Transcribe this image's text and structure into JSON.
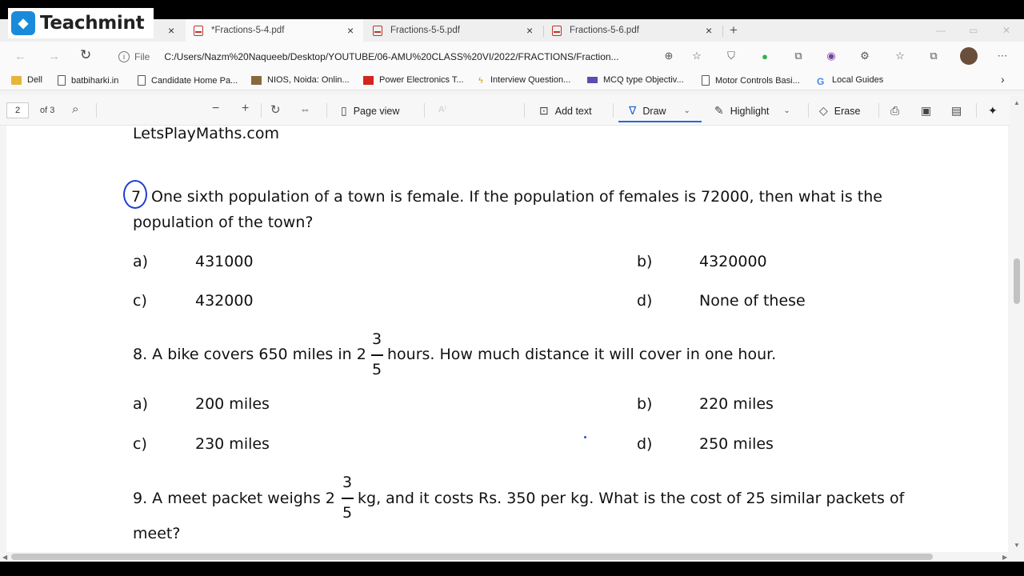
{
  "logo": {
    "text": "Teachmint"
  },
  "tabs": [
    {
      "title": "*Fractions-5-4.pdf"
    },
    {
      "title": "Fractions-5-5.pdf"
    },
    {
      "title": "Fractions-5-6.pdf"
    }
  ],
  "tab_close_glyph": "×",
  "new_tab_glyph": "+",
  "address": {
    "file_label": "File",
    "url": "C:/Users/Nazm%20Naqueeb/Desktop/YOUTUBE/06-AMU%20CLASS%20VI/2022/FRACTIONS/Fraction..."
  },
  "bookmarks": [
    {
      "label": "Dell",
      "icon": "folder-icon"
    },
    {
      "label": "batbiharki.in",
      "icon": "page-icon"
    },
    {
      "label": "Candidate Home Pa...",
      "icon": "page-icon"
    },
    {
      "label": "NIOS, Noida: Onlin...",
      "icon": "nios-icon"
    },
    {
      "label": "Power Electronics T...",
      "icon": "job-icon"
    },
    {
      "label": "Interview Question...",
      "icon": "bolt-icon"
    },
    {
      "label": "MCQ type Objectiv...",
      "icon": "mcq-icon"
    },
    {
      "label": "Motor Controls Basi...",
      "icon": "page-icon"
    },
    {
      "label": "Local Guides",
      "icon": "google-icon"
    }
  ],
  "pdf_toolbar": {
    "page_number": "2",
    "page_total": "of 3",
    "page_view": "Page view",
    "add_text": "Add text",
    "draw": "Draw",
    "highlight": "Highlight",
    "erase": "Erase"
  },
  "document": {
    "header": "LetsPlayMaths.com",
    "q7": {
      "number": "7",
      "line1": "One sixth population of a town is female. If the population of females is 72000, then what is the",
      "line2": "population of the town?",
      "options": [
        {
          "key": "a)",
          "value": "431000"
        },
        {
          "key": "b)",
          "value": "4320000"
        },
        {
          "key": "c)",
          "value": "432000"
        },
        {
          "key": "d)",
          "value": "None of these"
        }
      ]
    },
    "q8": {
      "prefix": "8. A bike covers 650 miles in 2",
      "frac_num": "3",
      "frac_den": "5",
      "suffix": "hours. How much distance it will cover in one hour.",
      "options": [
        {
          "key": "a)",
          "value": "200 miles"
        },
        {
          "key": "b)",
          "value": "220 miles"
        },
        {
          "key": "c)",
          "value": "230 miles"
        },
        {
          "key": "d)",
          "value": "250 miles"
        }
      ]
    },
    "q9": {
      "prefix": "9. A meet packet weighs 2",
      "frac_num": "3",
      "frac_den": "5",
      "suffix": "kg, and it costs Rs. 350 per kg. What is the cost of 25 similar packets of",
      "line2": "meet?"
    }
  },
  "colors": {
    "annotation": "#1f3fd0",
    "draw_accent": "#2b66d3",
    "pdf_red": "#c4322a"
  }
}
